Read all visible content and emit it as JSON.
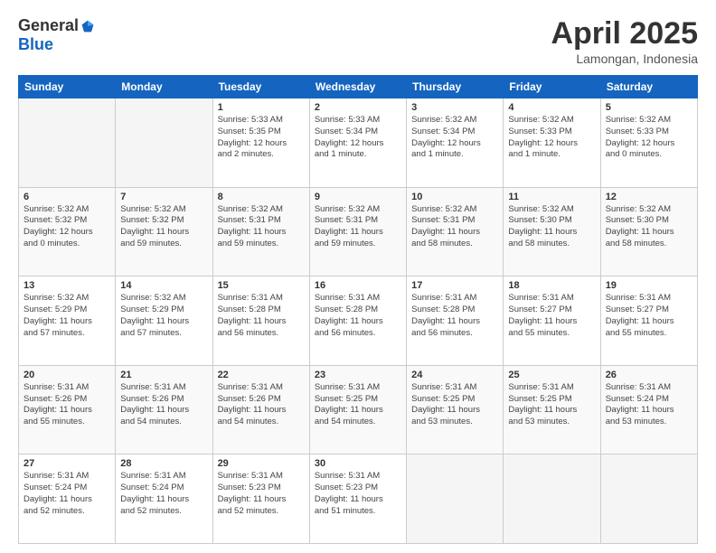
{
  "logo": {
    "general": "General",
    "blue": "Blue"
  },
  "title": {
    "month": "April 2025",
    "location": "Lamongan, Indonesia"
  },
  "headers": [
    "Sunday",
    "Monday",
    "Tuesday",
    "Wednesday",
    "Thursday",
    "Friday",
    "Saturday"
  ],
  "weeks": [
    [
      {
        "day": "",
        "info": ""
      },
      {
        "day": "",
        "info": ""
      },
      {
        "day": "1",
        "info": "Sunrise: 5:33 AM\nSunset: 5:35 PM\nDaylight: 12 hours\nand 2 minutes."
      },
      {
        "day": "2",
        "info": "Sunrise: 5:33 AM\nSunset: 5:34 PM\nDaylight: 12 hours\nand 1 minute."
      },
      {
        "day": "3",
        "info": "Sunrise: 5:32 AM\nSunset: 5:34 PM\nDaylight: 12 hours\nand 1 minute."
      },
      {
        "day": "4",
        "info": "Sunrise: 5:32 AM\nSunset: 5:33 PM\nDaylight: 12 hours\nand 1 minute."
      },
      {
        "day": "5",
        "info": "Sunrise: 5:32 AM\nSunset: 5:33 PM\nDaylight: 12 hours\nand 0 minutes."
      }
    ],
    [
      {
        "day": "6",
        "info": "Sunrise: 5:32 AM\nSunset: 5:32 PM\nDaylight: 12 hours\nand 0 minutes."
      },
      {
        "day": "7",
        "info": "Sunrise: 5:32 AM\nSunset: 5:32 PM\nDaylight: 11 hours\nand 59 minutes."
      },
      {
        "day": "8",
        "info": "Sunrise: 5:32 AM\nSunset: 5:31 PM\nDaylight: 11 hours\nand 59 minutes."
      },
      {
        "day": "9",
        "info": "Sunrise: 5:32 AM\nSunset: 5:31 PM\nDaylight: 11 hours\nand 59 minutes."
      },
      {
        "day": "10",
        "info": "Sunrise: 5:32 AM\nSunset: 5:31 PM\nDaylight: 11 hours\nand 58 minutes."
      },
      {
        "day": "11",
        "info": "Sunrise: 5:32 AM\nSunset: 5:30 PM\nDaylight: 11 hours\nand 58 minutes."
      },
      {
        "day": "12",
        "info": "Sunrise: 5:32 AM\nSunset: 5:30 PM\nDaylight: 11 hours\nand 58 minutes."
      }
    ],
    [
      {
        "day": "13",
        "info": "Sunrise: 5:32 AM\nSunset: 5:29 PM\nDaylight: 11 hours\nand 57 minutes."
      },
      {
        "day": "14",
        "info": "Sunrise: 5:32 AM\nSunset: 5:29 PM\nDaylight: 11 hours\nand 57 minutes."
      },
      {
        "day": "15",
        "info": "Sunrise: 5:31 AM\nSunset: 5:28 PM\nDaylight: 11 hours\nand 56 minutes."
      },
      {
        "day": "16",
        "info": "Sunrise: 5:31 AM\nSunset: 5:28 PM\nDaylight: 11 hours\nand 56 minutes."
      },
      {
        "day": "17",
        "info": "Sunrise: 5:31 AM\nSunset: 5:28 PM\nDaylight: 11 hours\nand 56 minutes."
      },
      {
        "day": "18",
        "info": "Sunrise: 5:31 AM\nSunset: 5:27 PM\nDaylight: 11 hours\nand 55 minutes."
      },
      {
        "day": "19",
        "info": "Sunrise: 5:31 AM\nSunset: 5:27 PM\nDaylight: 11 hours\nand 55 minutes."
      }
    ],
    [
      {
        "day": "20",
        "info": "Sunrise: 5:31 AM\nSunset: 5:26 PM\nDaylight: 11 hours\nand 55 minutes."
      },
      {
        "day": "21",
        "info": "Sunrise: 5:31 AM\nSunset: 5:26 PM\nDaylight: 11 hours\nand 54 minutes."
      },
      {
        "day": "22",
        "info": "Sunrise: 5:31 AM\nSunset: 5:26 PM\nDaylight: 11 hours\nand 54 minutes."
      },
      {
        "day": "23",
        "info": "Sunrise: 5:31 AM\nSunset: 5:25 PM\nDaylight: 11 hours\nand 54 minutes."
      },
      {
        "day": "24",
        "info": "Sunrise: 5:31 AM\nSunset: 5:25 PM\nDaylight: 11 hours\nand 53 minutes."
      },
      {
        "day": "25",
        "info": "Sunrise: 5:31 AM\nSunset: 5:25 PM\nDaylight: 11 hours\nand 53 minutes."
      },
      {
        "day": "26",
        "info": "Sunrise: 5:31 AM\nSunset: 5:24 PM\nDaylight: 11 hours\nand 53 minutes."
      }
    ],
    [
      {
        "day": "27",
        "info": "Sunrise: 5:31 AM\nSunset: 5:24 PM\nDaylight: 11 hours\nand 52 minutes."
      },
      {
        "day": "28",
        "info": "Sunrise: 5:31 AM\nSunset: 5:24 PM\nDaylight: 11 hours\nand 52 minutes."
      },
      {
        "day": "29",
        "info": "Sunrise: 5:31 AM\nSunset: 5:23 PM\nDaylight: 11 hours\nand 52 minutes."
      },
      {
        "day": "30",
        "info": "Sunrise: 5:31 AM\nSunset: 5:23 PM\nDaylight: 11 hours\nand 51 minutes."
      },
      {
        "day": "",
        "info": ""
      },
      {
        "day": "",
        "info": ""
      },
      {
        "day": "",
        "info": ""
      }
    ]
  ]
}
